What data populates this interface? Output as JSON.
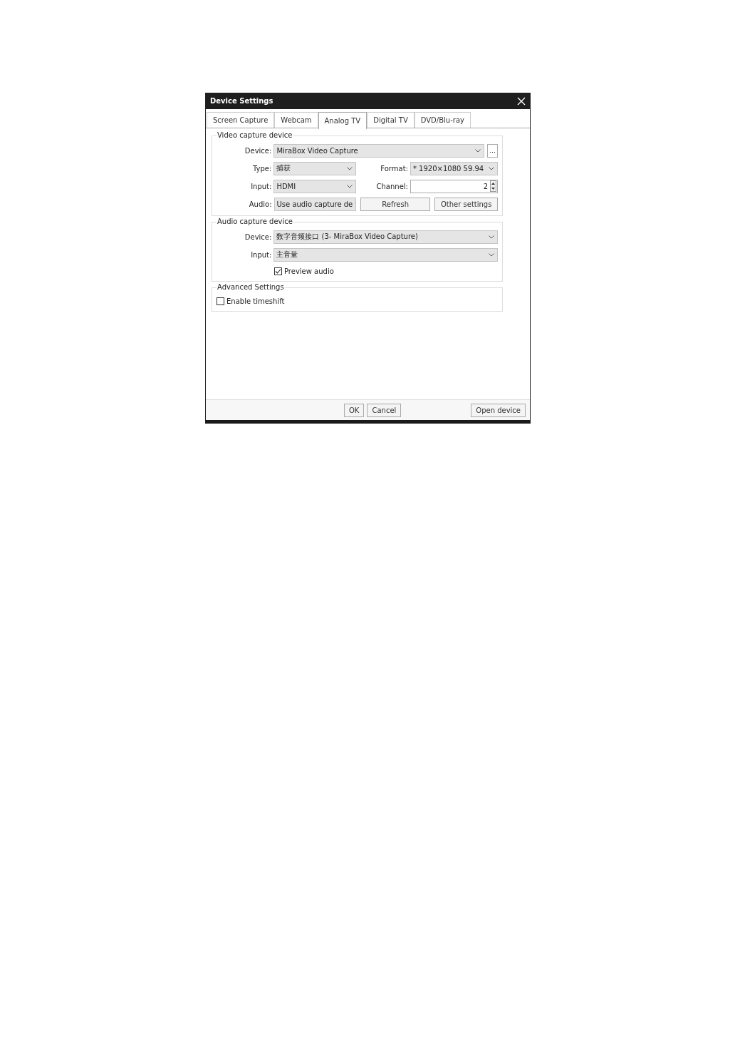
{
  "window": {
    "title": "Device Settings"
  },
  "tabs": [
    {
      "label": "Screen Capture",
      "selected": false
    },
    {
      "label": "Webcam",
      "selected": false
    },
    {
      "label": "Analog TV",
      "selected": true
    },
    {
      "label": "Digital TV",
      "selected": false
    },
    {
      "label": "DVD/Blu-ray",
      "selected": false
    }
  ],
  "video_capture": {
    "title": "Video capture device",
    "device": {
      "label": "Device:",
      "value": "MiraBox Video Capture"
    },
    "more_button": "...",
    "type": {
      "label": "Type:",
      "value": "捕获"
    },
    "format": {
      "label": "Format:",
      "value": "* 1920×1080 59.94"
    },
    "input": {
      "label": "Input:",
      "value": "HDMI"
    },
    "channel": {
      "label": "Channel:",
      "value": "2"
    },
    "audio": {
      "label": "Audio:",
      "value": "Use audio capture de"
    },
    "buttons": [
      "Refresh",
      "Other settings"
    ]
  },
  "audio_capture": {
    "title": "Audio capture device",
    "device": {
      "label": "Device:",
      "value": "数字音频接口 (3- MiraBox Video Capture)"
    },
    "input": {
      "label": "Input:",
      "value": "主音量"
    },
    "preview": {
      "label": "Preview audio",
      "checked": true
    }
  },
  "advanced": {
    "title": "Advanced Settings",
    "timeshift": {
      "label": "Enable timeshift",
      "checked": false
    }
  },
  "footer": {
    "buttons": [
      "OK",
      "Cancel"
    ],
    "open_button": "Open device"
  }
}
